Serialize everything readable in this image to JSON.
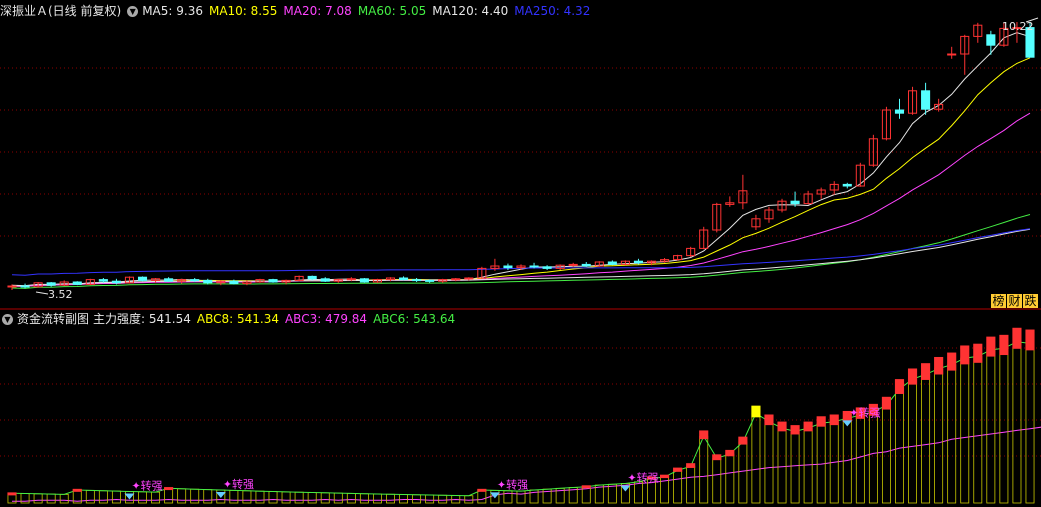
{
  "main": {
    "stock_title": "深振业Ａ(日线 前复权)",
    "ma": [
      {
        "label": "MA5: 9.36",
        "color": "#e6e6e6"
      },
      {
        "label": "MA10: 8.55",
        "color": "#ffff00"
      },
      {
        "label": "MA20: 7.08",
        "color": "#ff44ff"
      },
      {
        "label": "MA60: 5.05",
        "color": "#44ee44"
      },
      {
        "label": "MA120: 4.40",
        "color": "#e6e6e6"
      },
      {
        "label": "MA250: 4.32",
        "color": "#3333ff"
      }
    ],
    "high_label": "10.22",
    "low_label": "3.52"
  },
  "buttons": [
    {
      "label": "榜",
      "color": "#ffcc33"
    },
    {
      "label": "财",
      "color": "#ffcc33"
    },
    {
      "label": "跌",
      "color": "#ffcc33"
    }
  ],
  "sub": {
    "title": "资金流转副图",
    "items": [
      {
        "label": "主力强度: 541.54",
        "color": "#e6e6e6"
      },
      {
        "label": "ABC8: 541.34",
        "color": "#ffff00"
      },
      {
        "label": "ABC3: 479.84",
        "color": "#ff44ff"
      },
      {
        "label": "ABC6: 543.64",
        "color": "#44ee44"
      }
    ],
    "signal_label": "转强"
  },
  "colors": {
    "up": "#ff3333",
    "down": "#55ffff",
    "grid": "#8b0000",
    "magenta": "#ff44ff"
  },
  "chart_data": {
    "type": "candlestick",
    "price_high": 10.22,
    "price_low": 3.52,
    "candles": [
      [
        3.6,
        3.66,
        3.52,
        3.62
      ],
      [
        3.62,
        3.68,
        3.56,
        3.6
      ],
      [
        3.6,
        3.72,
        3.58,
        3.7
      ],
      [
        3.7,
        3.72,
        3.6,
        3.64
      ],
      [
        3.64,
        3.76,
        3.62,
        3.72
      ],
      [
        3.72,
        3.74,
        3.64,
        3.66
      ],
      [
        3.66,
        3.8,
        3.64,
        3.78
      ],
      [
        3.78,
        3.82,
        3.7,
        3.74
      ],
      [
        3.74,
        3.8,
        3.66,
        3.7
      ],
      [
        3.7,
        3.86,
        3.68,
        3.84
      ],
      [
        3.84,
        3.86,
        3.74,
        3.76
      ],
      [
        3.76,
        3.82,
        3.7,
        3.8
      ],
      [
        3.8,
        3.84,
        3.72,
        3.74
      ],
      [
        3.74,
        3.8,
        3.68,
        3.78
      ],
      [
        3.78,
        3.82,
        3.72,
        3.76
      ],
      [
        3.76,
        3.8,
        3.66,
        3.7
      ],
      [
        3.7,
        3.76,
        3.64,
        3.74
      ],
      [
        3.74,
        3.78,
        3.66,
        3.68
      ],
      [
        3.68,
        3.76,
        3.64,
        3.72
      ],
      [
        3.72,
        3.8,
        3.7,
        3.78
      ],
      [
        3.78,
        3.8,
        3.7,
        3.72
      ],
      [
        3.72,
        3.78,
        3.66,
        3.76
      ],
      [
        3.76,
        3.88,
        3.74,
        3.86
      ],
      [
        3.86,
        3.88,
        3.76,
        3.8
      ],
      [
        3.8,
        3.84,
        3.72,
        3.74
      ],
      [
        3.74,
        3.8,
        3.7,
        3.78
      ],
      [
        3.78,
        3.84,
        3.74,
        3.8
      ],
      [
        3.8,
        3.82,
        3.7,
        3.72
      ],
      [
        3.72,
        3.8,
        3.7,
        3.78
      ],
      [
        3.78,
        3.84,
        3.74,
        3.82
      ],
      [
        3.82,
        3.86,
        3.76,
        3.78
      ],
      [
        3.78,
        3.82,
        3.72,
        3.76
      ],
      [
        3.76,
        3.78,
        3.7,
        3.74
      ],
      [
        3.74,
        3.8,
        3.7,
        3.78
      ],
      [
        3.78,
        3.82,
        3.74,
        3.8
      ],
      [
        3.8,
        3.84,
        3.76,
        3.82
      ],
      [
        3.82,
        4.1,
        3.8,
        4.06
      ],
      [
        4.06,
        4.3,
        4.0,
        4.12
      ],
      [
        4.12,
        4.18,
        4.02,
        4.08
      ],
      [
        4.08,
        4.16,
        4.02,
        4.12
      ],
      [
        4.12,
        4.2,
        4.06,
        4.1
      ],
      [
        4.1,
        4.14,
        4.02,
        4.06
      ],
      [
        4.06,
        4.16,
        4.02,
        4.14
      ],
      [
        4.14,
        4.2,
        4.1,
        4.16
      ],
      [
        4.16,
        4.22,
        4.1,
        4.12
      ],
      [
        4.12,
        4.24,
        4.1,
        4.22
      ],
      [
        4.22,
        4.26,
        4.14,
        4.16
      ],
      [
        4.16,
        4.26,
        4.14,
        4.24
      ],
      [
        4.24,
        4.3,
        4.16,
        4.2
      ],
      [
        4.2,
        4.26,
        4.14,
        4.24
      ],
      [
        4.24,
        4.32,
        4.2,
        4.28
      ],
      [
        4.28,
        4.4,
        4.26,
        4.38
      ],
      [
        4.38,
        4.6,
        4.34,
        4.56
      ],
      [
        4.56,
        5.1,
        4.54,
        5.02
      ],
      [
        5.02,
        5.7,
        4.96,
        5.66
      ],
      [
        5.66,
        5.86,
        5.6,
        5.7
      ],
      [
        5.7,
        6.4,
        5.54,
        6.0
      ],
      [
        5.1,
        5.4,
        5.02,
        5.3
      ],
      [
        5.3,
        5.6,
        5.2,
        5.52
      ],
      [
        5.52,
        5.8,
        5.46,
        5.74
      ],
      [
        5.74,
        5.98,
        5.6,
        5.68
      ],
      [
        5.68,
        6.0,
        5.66,
        5.92
      ],
      [
        5.92,
        6.08,
        5.8,
        6.02
      ],
      [
        6.02,
        6.24,
        5.9,
        6.16
      ],
      [
        6.16,
        6.2,
        6.06,
        6.12
      ],
      [
        6.12,
        6.7,
        6.1,
        6.64
      ],
      [
        6.64,
        7.4,
        6.6,
        7.3
      ],
      [
        7.3,
        8.1,
        7.26,
        8.02
      ],
      [
        8.02,
        8.3,
        7.8,
        7.94
      ],
      [
        7.94,
        8.6,
        7.9,
        8.5
      ],
      [
        8.5,
        8.7,
        7.9,
        8.04
      ],
      [
        8.04,
        8.3,
        7.98,
        8.16
      ],
      [
        9.4,
        9.6,
        9.3,
        9.42
      ],
      [
        9.42,
        9.9,
        8.9,
        9.86
      ],
      [
        9.86,
        10.2,
        9.7,
        10.14
      ],
      [
        9.9,
        10.0,
        9.4,
        9.64
      ],
      [
        9.64,
        10.2,
        9.6,
        10.06
      ],
      [
        10.06,
        10.22,
        9.7,
        10.08
      ],
      [
        10.08,
        10.22,
        9.34,
        9.34
      ]
    ],
    "sub_bars": [
      2,
      2,
      3,
      3,
      3,
      2,
      3,
      3,
      4,
      3,
      3,
      3,
      4,
      3,
      3,
      3,
      4,
      3,
      3,
      3,
      4,
      3,
      3,
      3,
      4,
      3,
      4,
      3,
      3,
      3,
      4,
      4,
      3,
      3,
      4,
      3,
      4,
      9,
      11,
      10,
      12,
      13,
      14,
      15,
      16,
      18,
      19,
      20,
      22,
      23,
      25,
      27,
      29,
      30,
      32,
      34,
      36,
      38,
      40,
      41,
      42,
      43,
      44,
      46,
      48,
      52,
      56,
      58,
      62,
      64,
      66,
      68,
      72,
      74,
      76,
      78,
      80,
      82,
      84,
      86,
      88,
      90
    ],
    "sub_peaks": [
      {
        "i": 0,
        "v": 12
      },
      {
        "i": 5,
        "v": 16
      },
      {
        "i": 12,
        "v": 18
      },
      {
        "i": 36,
        "v": 16
      },
      {
        "i": 44,
        "v": 20
      },
      {
        "i": 49,
        "v": 30
      },
      {
        "i": 50,
        "v": 32
      },
      {
        "i": 51,
        "v": 40
      },
      {
        "i": 52,
        "v": 45
      },
      {
        "i": 53,
        "v": 82
      },
      {
        "i": 54,
        "v": 55
      },
      {
        "i": 55,
        "v": 60
      },
      {
        "i": 56,
        "v": 75
      },
      {
        "i": 57,
        "v": 110
      },
      {
        "i": 58,
        "v": 100
      },
      {
        "i": 59,
        "v": 92
      },
      {
        "i": 60,
        "v": 88
      },
      {
        "i": 61,
        "v": 92
      },
      {
        "i": 62,
        "v": 98
      },
      {
        "i": 63,
        "v": 100
      },
      {
        "i": 64,
        "v": 104
      },
      {
        "i": 65,
        "v": 108
      },
      {
        "i": 66,
        "v": 112
      },
      {
        "i": 67,
        "v": 120
      },
      {
        "i": 68,
        "v": 140
      },
      {
        "i": 69,
        "v": 152
      },
      {
        "i": 70,
        "v": 158
      },
      {
        "i": 71,
        "v": 165
      },
      {
        "i": 72,
        "v": 170
      },
      {
        "i": 73,
        "v": 178
      },
      {
        "i": 74,
        "v": 180
      },
      {
        "i": 75,
        "v": 188
      },
      {
        "i": 76,
        "v": 190
      },
      {
        "i": 77,
        "v": 198
      },
      {
        "i": 78,
        "v": 196
      }
    ],
    "signals": [
      9,
      16,
      37,
      47,
      64
    ]
  }
}
